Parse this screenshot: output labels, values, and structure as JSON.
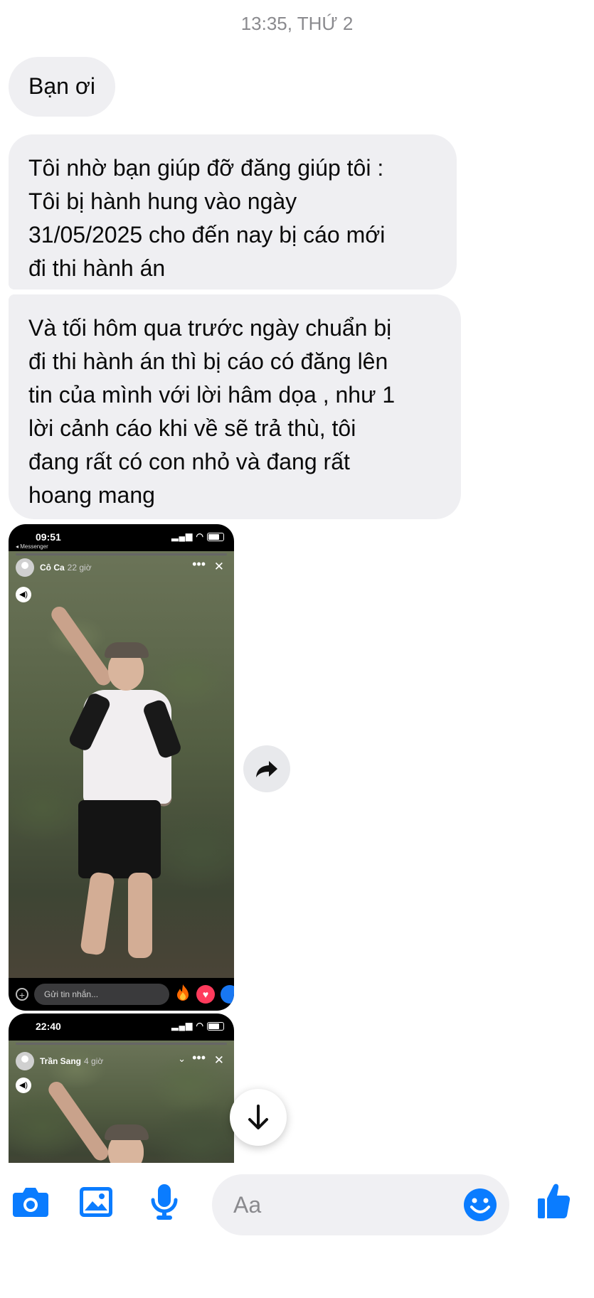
{
  "header": {
    "timestamp": "13:35, THỨ 2"
  },
  "messages": [
    {
      "text": "Bạn ơi"
    },
    {
      "text": "Tôi nhờ bạn giúp đỡ đăng giúp tôi :\nTôi bị hành hung vào ngày\n31/05/2025 cho đến nay bị cáo mới\nđi thi hành án"
    },
    {
      "text": "Và tối hôm qua trước ngày chuẩn bị\nđi thi hành án thì bị cáo có đăng lên\ntin của mình với lời hâm dọa , như 1\nlời cảnh cáo khi về sẽ trả thù, tôi\nđang rất có con nhỏ và đang rất\nhoang mang"
    }
  ],
  "attachments": [
    {
      "clock": "09:51",
      "back_label": "◂ Messenger",
      "story_user": "Cô Ca",
      "story_time": "22 giờ",
      "reply_placeholder": "Gửi tin nhắn..."
    },
    {
      "clock": "22:40",
      "story_user": "Trần Sang",
      "story_time": "4 giờ"
    }
  ],
  "composer": {
    "placeholder": "Aa",
    "icons": [
      "camera-icon",
      "gallery-icon",
      "microphone-icon",
      "emoji-icon",
      "thumbs-up-icon"
    ]
  },
  "colors": {
    "accent": "#0a7cff",
    "bubble": "#efeff2",
    "timestamp": "#8a8a8e"
  }
}
